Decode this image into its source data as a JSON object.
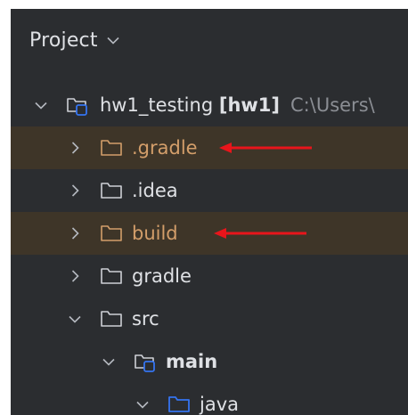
{
  "header": {
    "title": "Project"
  },
  "tree": {
    "root": {
      "name": "hw1_testing",
      "module": "[hw1]",
      "path": "C:\\Users\\"
    },
    "items": [
      {
        "label": ".gradle"
      },
      {
        "label": ".idea"
      },
      {
        "label": "build"
      },
      {
        "label": "gradle"
      },
      {
        "label": "src"
      },
      {
        "label": "main"
      },
      {
        "label": "java"
      }
    ]
  },
  "colors": {
    "panel_bg": "#2b2d30",
    "excluded_bg": "#3e3528",
    "excluded_text": "#d39e6a",
    "text": "#dfe1e5",
    "muted": "#8b8e94",
    "module_blue": "#3574f0",
    "annotation_arrow": "#e8151b"
  }
}
